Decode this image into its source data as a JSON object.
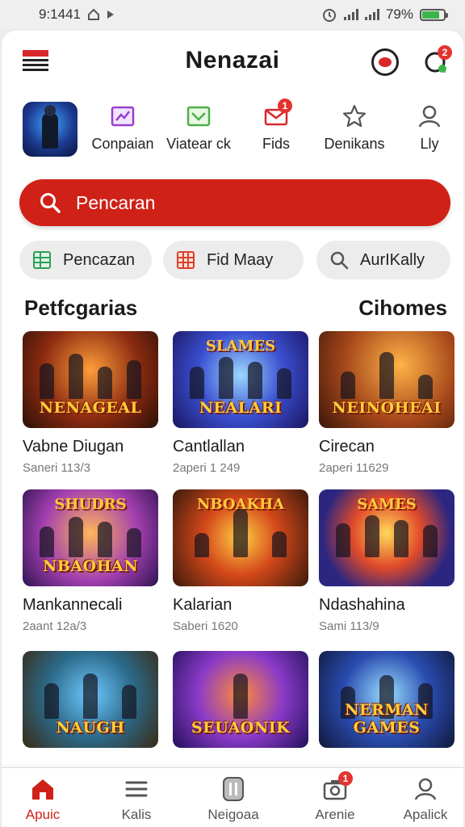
{
  "status_bar": {
    "time": "9:1441",
    "battery": "79%",
    "battery_level": 0.79
  },
  "header": {
    "title": "Nenazai",
    "chat_badge": "2"
  },
  "shortcuts": [
    {
      "label": "Conpaian",
      "icon": "chart-icon"
    },
    {
      "label": "Viatear ck",
      "icon": "image-icon"
    },
    {
      "label": "Fids",
      "icon": "mail-icon",
      "badge": "1"
    },
    {
      "label": "Denikans",
      "icon": "star-icon"
    },
    {
      "label": "Lly",
      "icon": "user-icon"
    }
  ],
  "search": {
    "placeholder": "Pencaran"
  },
  "chips": [
    {
      "label": "Pencazan",
      "icon": "grid-icon"
    },
    {
      "label": "Fid Maay",
      "icon": "table-icon"
    },
    {
      "label": "AurIKally",
      "icon": "search-icon"
    }
  ],
  "section": {
    "left_title": "Petfcgarias",
    "right_title": "Cihomes"
  },
  "games": [
    {
      "name": "Vabne Diugan",
      "meta": "Saneri 113/3",
      "banner": "NENAGEAL",
      "top": ""
    },
    {
      "name": "Cantlallan",
      "meta": "2aperi 1 249",
      "banner": "NEALARI",
      "top": "SLAMES"
    },
    {
      "name": "Cirecan",
      "meta": "2aperi 11629",
      "banner": "NEINOHEAI",
      "top": ""
    },
    {
      "name": "Mankannecali",
      "meta": "2aant 12a/3",
      "banner": "NBAOHAN",
      "top": "SHUDRS"
    },
    {
      "name": "Kalarian",
      "meta": "Saberi 1620",
      "banner": "",
      "top": "NBOAKHA"
    },
    {
      "name": "Ndashahina",
      "meta": "Sami 113/9",
      "banner": "",
      "top": "SAMES"
    },
    {
      "name": "",
      "meta": "",
      "banner": "NAUGH",
      "top": ""
    },
    {
      "name": "",
      "meta": "",
      "banner": "SEUAONIK",
      "top": ""
    },
    {
      "name": "",
      "meta": "",
      "banner": "NERMAN GAMES",
      "top": ""
    }
  ],
  "bottom_nav": [
    {
      "label": "Apuic",
      "icon": "home-icon",
      "active": true
    },
    {
      "label": "Kalis",
      "icon": "menu-icon"
    },
    {
      "label": "Neigoaa",
      "icon": "pause-icon"
    },
    {
      "label": "Arenie",
      "icon": "camera-icon",
      "badge": "1"
    },
    {
      "label": "Apalick",
      "icon": "profile-icon"
    }
  ],
  "colors": {
    "accent": "#cf2117",
    "badge": "#e3342f",
    "battery": "#3bb54a"
  }
}
